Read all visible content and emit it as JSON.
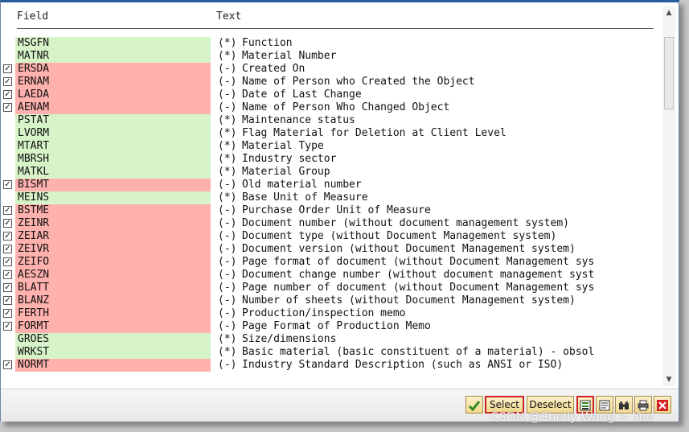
{
  "header": {
    "field_label": "Field",
    "text_label": "Text"
  },
  "rows": [
    {
      "field": "MSGFN",
      "selected": false,
      "symbol": "(*)",
      "text": "Function"
    },
    {
      "field": "MATNR",
      "selected": false,
      "symbol": "(*)",
      "text": "Material Number"
    },
    {
      "field": "ERSDA",
      "selected": true,
      "symbol": "(-)",
      "text": "Created On"
    },
    {
      "field": "ERNAM",
      "selected": true,
      "symbol": "(-)",
      "text": "Name of Person who Created the Object"
    },
    {
      "field": "LAEDA",
      "selected": true,
      "symbol": "(-)",
      "text": "Date of Last Change"
    },
    {
      "field": "AENAM",
      "selected": true,
      "symbol": "(-)",
      "text": "Name of Person Who Changed Object"
    },
    {
      "field": "PSTAT",
      "selected": false,
      "symbol": "(*)",
      "text": "Maintenance status"
    },
    {
      "field": "LVORM",
      "selected": false,
      "symbol": "(*)",
      "text": "Flag Material for Deletion at Client Level"
    },
    {
      "field": "MTART",
      "selected": false,
      "symbol": "(*)",
      "text": "Material Type"
    },
    {
      "field": "MBRSH",
      "selected": false,
      "symbol": "(*)",
      "text": "Industry sector"
    },
    {
      "field": "MATKL",
      "selected": false,
      "symbol": "(*)",
      "text": "Material Group"
    },
    {
      "field": "BISMT",
      "selected": true,
      "symbol": "(-)",
      "text": "Old material number"
    },
    {
      "field": "MEINS",
      "selected": false,
      "symbol": "(*)",
      "text": "Base Unit of Measure"
    },
    {
      "field": "BSTME",
      "selected": true,
      "symbol": "(-)",
      "text": "Purchase Order Unit of Measure"
    },
    {
      "field": "ZEINR",
      "selected": true,
      "symbol": "(-)",
      "text": "Document number (without document management system)"
    },
    {
      "field": "ZEIAR",
      "selected": true,
      "symbol": "(-)",
      "text": "Document type (without Document Management system)"
    },
    {
      "field": "ZEIVR",
      "selected": true,
      "symbol": "(-)",
      "text": "Document version (without Document Management system)"
    },
    {
      "field": "ZEIFO",
      "selected": true,
      "symbol": "(-)",
      "text": "Page format of document (without Document Management sys"
    },
    {
      "field": "AESZN",
      "selected": true,
      "symbol": "(-)",
      "text": "Document change number (without document management syst"
    },
    {
      "field": "BLATT",
      "selected": true,
      "symbol": "(-)",
      "text": "Page number of document (without Document Management sys"
    },
    {
      "field": "BLANZ",
      "selected": true,
      "symbol": "(-)",
      "text": "Number of sheets (without Document Management system)"
    },
    {
      "field": "FERTH",
      "selected": true,
      "symbol": "(-)",
      "text": "Production/inspection memo"
    },
    {
      "field": "FORMT",
      "selected": true,
      "symbol": "(-)",
      "text": "Page Format of Production Memo"
    },
    {
      "field": "GROES",
      "selected": false,
      "symbol": "(*)",
      "text": "Size/dimensions"
    },
    {
      "field": "WRKST",
      "selected": false,
      "symbol": "(*)",
      "text": "Basic material (basic constituent of a material) - obsol"
    },
    {
      "field": "NORMT",
      "selected": true,
      "symbol": "(-)",
      "text": "Industry Standard Description (such as ANSI or ISO)"
    }
  ],
  "footer": {
    "confirm_icon": "checkmark-icon",
    "select_label": "Select",
    "deselect_label": "Deselect",
    "select_all_icon": "select-block-icon",
    "details_icon": "details-icon",
    "find_icon": "binoculars-icon",
    "print_icon": "printer-icon",
    "cancel_icon": "cancel-icon"
  },
  "watermark": "CSDN @Shelly Wang ~ Yue",
  "colors": {
    "selected_bg": "#ffb1ad",
    "unselected_bg": "#d7f4c9",
    "button_bg": "#f2d98f",
    "highlight_border": "#cc2222"
  }
}
